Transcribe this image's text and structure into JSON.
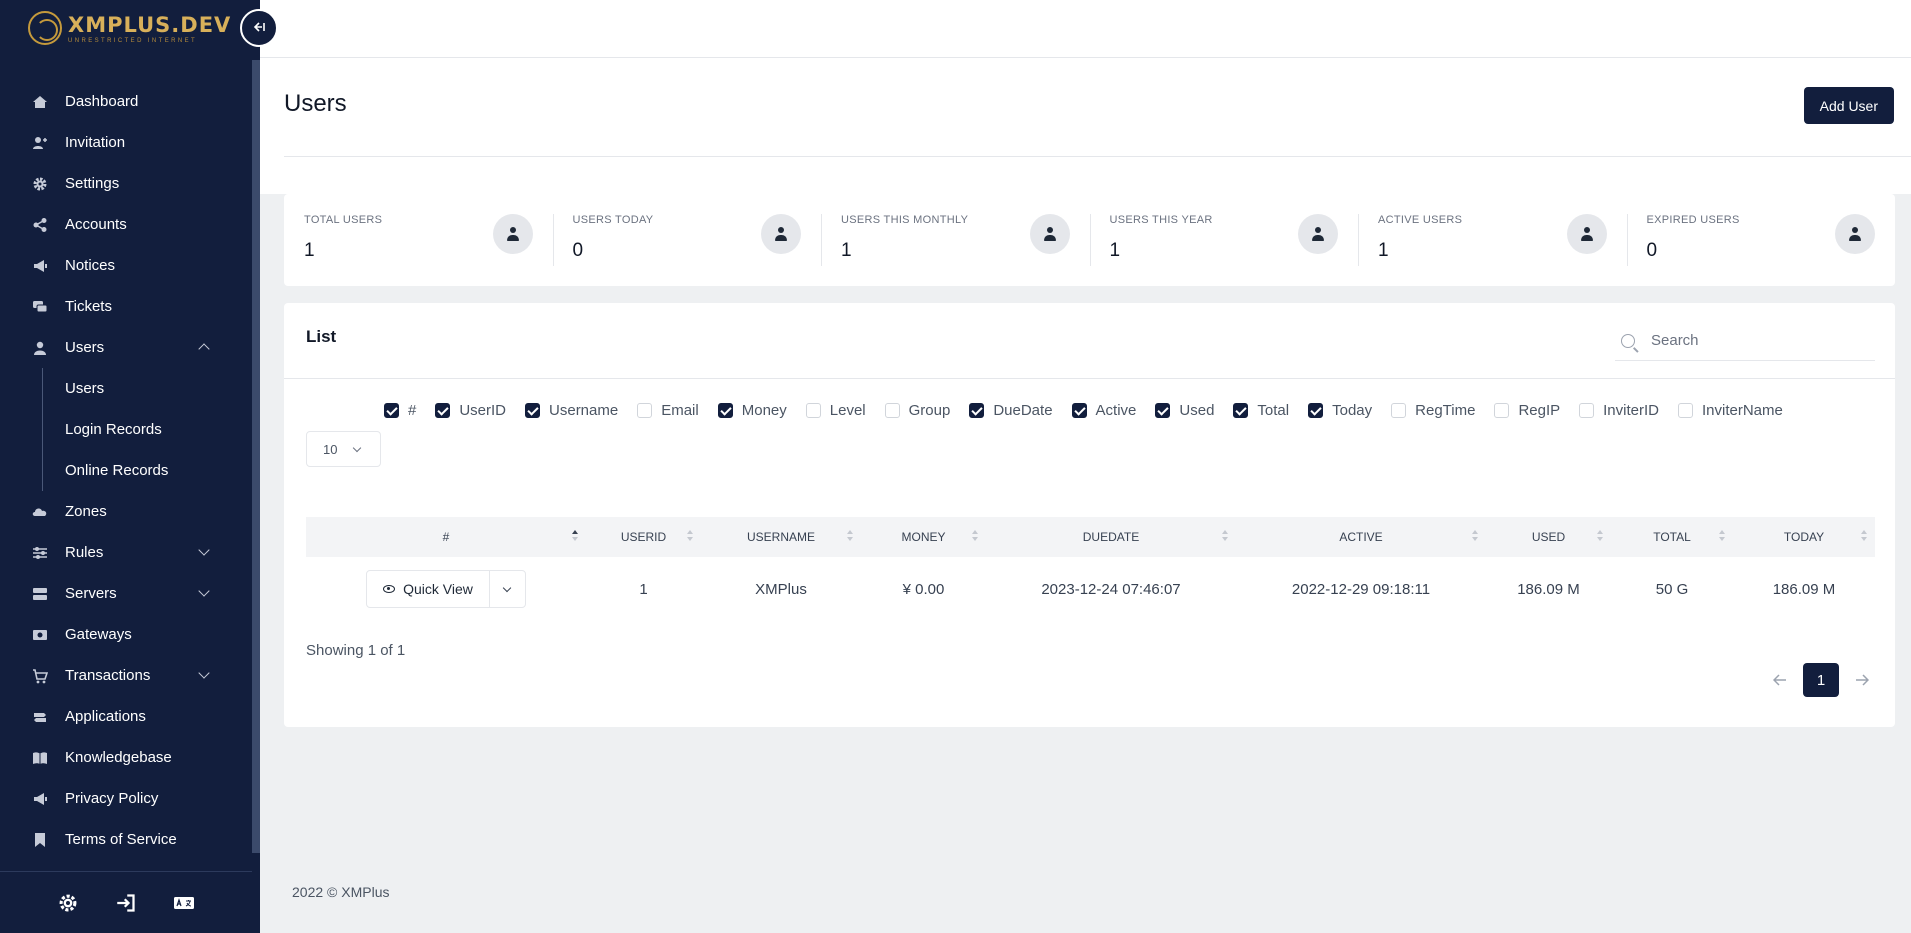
{
  "brand": {
    "title": "XMPLUS.DEV",
    "subtitle": "UNRESTRICTED INTERNET"
  },
  "sidebar": {
    "collapse_icon": "collapse-left-icon",
    "items": [
      {
        "label": "Dashboard",
        "icon": "home-icon"
      },
      {
        "label": "Invitation",
        "icon": "user-plus-icon"
      },
      {
        "label": "Settings",
        "icon": "gear-icon"
      },
      {
        "label": "Accounts",
        "icon": "share-icon"
      },
      {
        "label": "Notices",
        "icon": "megaphone-icon"
      },
      {
        "label": "Tickets",
        "icon": "chat-icon"
      },
      {
        "label": "Users",
        "icon": "user-icon",
        "expanded": true
      },
      {
        "label": "Zones",
        "icon": "cloud-icon"
      },
      {
        "label": "Rules",
        "icon": "sliders-icon"
      },
      {
        "label": "Servers",
        "icon": "server-icon"
      },
      {
        "label": "Gateways",
        "icon": "money-icon"
      },
      {
        "label": "Transactions",
        "icon": "cart-icon"
      },
      {
        "label": "Applications",
        "icon": "signpost-icon"
      },
      {
        "label": "Knowledgebase",
        "icon": "book-icon"
      },
      {
        "label": "Privacy Policy",
        "icon": "megaphone-icon"
      },
      {
        "label": "Terms of Service",
        "icon": "bookmark-icon"
      }
    ],
    "users_sub": [
      "Users",
      "Login Records",
      "Online Records"
    ],
    "footer_icons": [
      "settings-icon",
      "login-icon",
      "language-icon"
    ]
  },
  "header": {
    "title": "Users",
    "add_button": "Add User"
  },
  "stats": [
    {
      "label": "TOTAL USERS",
      "value": "1"
    },
    {
      "label": "USERS TODAY",
      "value": "0"
    },
    {
      "label": "USERS THIS MONTHLY",
      "value": "1"
    },
    {
      "label": "USERS THIS YEAR",
      "value": "1"
    },
    {
      "label": "ACTIVE USERS",
      "value": "1"
    },
    {
      "label": "EXPIRED USERS",
      "value": "0"
    }
  ],
  "list": {
    "title": "List",
    "search_placeholder": "Search",
    "columns": [
      {
        "label": "#",
        "checked": true
      },
      {
        "label": "UserID",
        "checked": true
      },
      {
        "label": "Username",
        "checked": true
      },
      {
        "label": "Email",
        "checked": false
      },
      {
        "label": "Money",
        "checked": true
      },
      {
        "label": "Level",
        "checked": false
      },
      {
        "label": "Group",
        "checked": false
      },
      {
        "label": "DueDate",
        "checked": true
      },
      {
        "label": "Active",
        "checked": true
      },
      {
        "label": "Used",
        "checked": true
      },
      {
        "label": "Total",
        "checked": true
      },
      {
        "label": "Today",
        "checked": true
      },
      {
        "label": "RegTime",
        "checked": false
      },
      {
        "label": "RegIP",
        "checked": false
      },
      {
        "label": "InviterID",
        "checked": false
      },
      {
        "label": "InviterName",
        "checked": false
      }
    ],
    "page_size": "10",
    "table": {
      "headers": [
        "#",
        "USERID",
        "USERNAME",
        "MONEY",
        "DUEDATE",
        "ACTIVE",
        "USED",
        "TOTAL",
        "TODAY"
      ],
      "rows": [
        {
          "action": "Quick View",
          "userid": "1",
          "username": "XMPlus",
          "money": "¥ 0.00",
          "duedate": "2023-12-24 07:46:07",
          "active": "2022-12-29 09:18:11",
          "used": "186.09 M",
          "total": "50 G",
          "today": "186.09 M"
        }
      ]
    },
    "showing": "Showing 1 of 1",
    "pagination": {
      "current": "1"
    }
  },
  "footer": {
    "copyright": "2022 © XMPlus"
  }
}
